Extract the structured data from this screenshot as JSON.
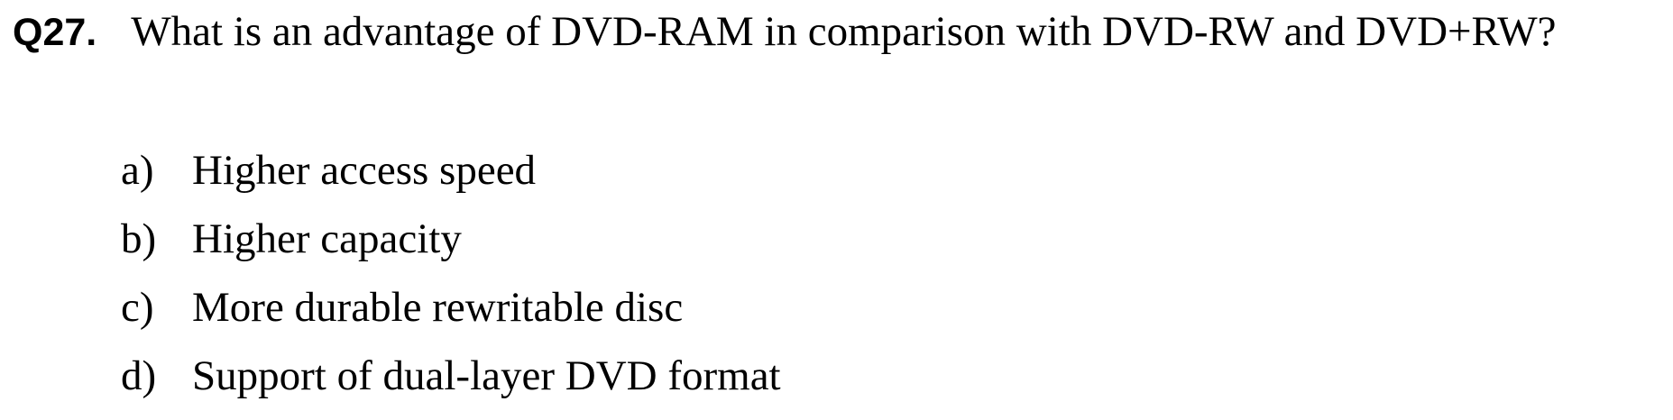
{
  "question": {
    "number": "Q27.",
    "text": "What is an advantage of DVD-RAM in comparison with DVD-RW and DVD+RW?"
  },
  "options": [
    {
      "letter": "a)",
      "text": "Higher access speed"
    },
    {
      "letter": "b)",
      "text": "Higher capacity"
    },
    {
      "letter": "c)",
      "text": "More durable rewritable disc"
    },
    {
      "letter": "d)",
      "text": "Support of dual-layer DVD format"
    }
  ]
}
